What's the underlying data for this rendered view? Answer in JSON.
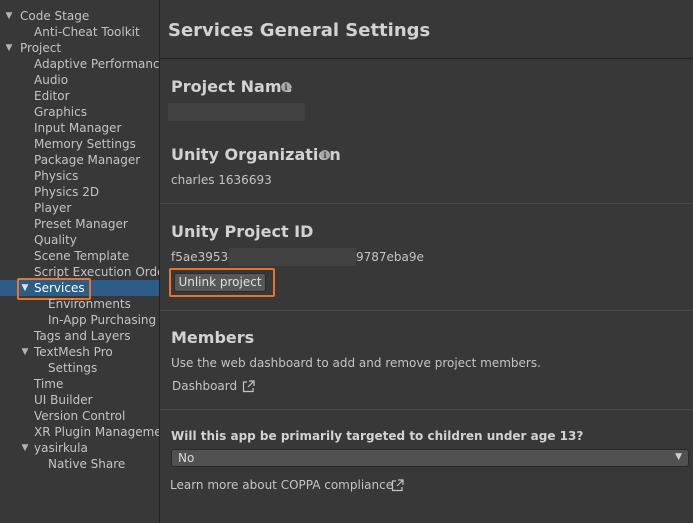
{
  "sidebar": {
    "items": [
      {
        "label": "Code Stage",
        "expanded": true
      },
      {
        "label": "Anti-Cheat Toolkit"
      },
      {
        "label": "Project",
        "expanded": true
      },
      {
        "label": "Adaptive Performance"
      },
      {
        "label": "Audio"
      },
      {
        "label": "Editor"
      },
      {
        "label": "Graphics"
      },
      {
        "label": "Input Manager"
      },
      {
        "label": "Memory Settings"
      },
      {
        "label": "Package Manager"
      },
      {
        "label": "Physics"
      },
      {
        "label": "Physics 2D"
      },
      {
        "label": "Player"
      },
      {
        "label": "Preset Manager"
      },
      {
        "label": "Quality"
      },
      {
        "label": "Scene Template"
      },
      {
        "label": "Script Execution Order"
      },
      {
        "label": "Services",
        "expanded": true,
        "selected": true
      },
      {
        "label": "Environments"
      },
      {
        "label": "In-App Purchasing"
      },
      {
        "label": "Tags and Layers"
      },
      {
        "label": "TextMesh Pro",
        "expanded": true
      },
      {
        "label": "Settings"
      },
      {
        "label": "Time"
      },
      {
        "label": "UI Builder"
      },
      {
        "label": "Version Control"
      },
      {
        "label": "XR Plugin Management"
      },
      {
        "label": "yasirkula",
        "expanded": true
      },
      {
        "label": "Native Share"
      }
    ]
  },
  "main": {
    "title": "Services General Settings",
    "project_name": {
      "heading": "Project Name"
    },
    "organization": {
      "heading": "Unity Organization",
      "value": "charles 1636693"
    },
    "project_id": {
      "heading": "Unity Project ID",
      "value_prefix": "f5ae3953-",
      "value_suffix": "9787eba9e",
      "unlink_label": "Unlink project"
    },
    "members": {
      "heading": "Members",
      "description": "Use the web dashboard to add and remove project members.",
      "dashboard_link": "Dashboard"
    },
    "coppa": {
      "question": "Will this app be primarily targeted to children under age 13?",
      "selected": "No",
      "learn_more": "Learn more about COPPA compliance"
    }
  },
  "colors": {
    "selection": "#2c5d87",
    "highlight": "#e8742a",
    "background": "#383838"
  }
}
